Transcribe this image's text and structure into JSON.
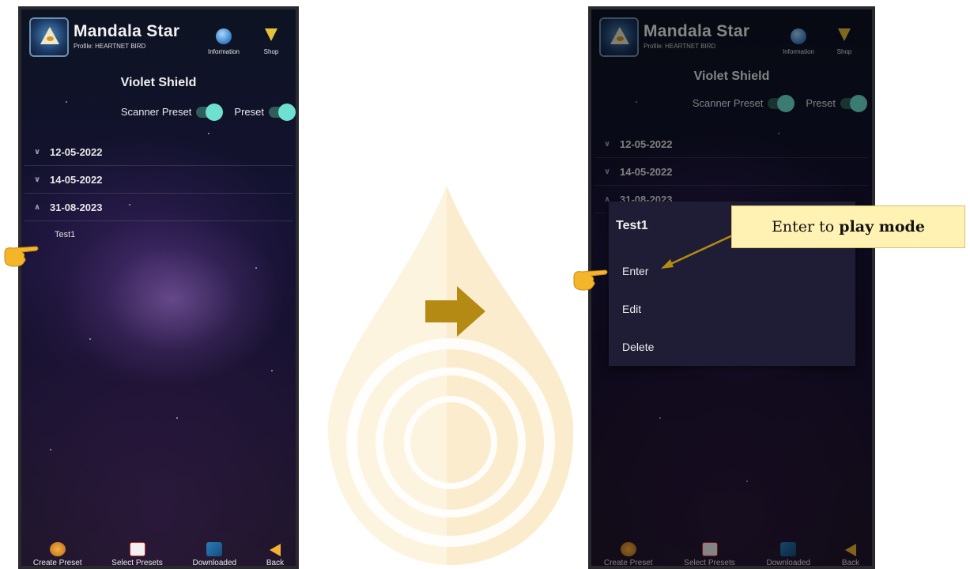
{
  "colors": {
    "accent_toggle": "#6ee0cf",
    "callout_bg": "#fff2b3",
    "arrow": "#b58a14",
    "hand": "#f5b52a"
  },
  "screens": [
    {
      "app_title": "Mandala Star",
      "profile_label": "Profile:",
      "profile_name": "HEARTNET BIRD",
      "info_label": "Information",
      "shop_label": "Shop",
      "preset_title": "Violet Shield",
      "toggle_scanner_label": "Scanner Preset",
      "toggle_preset_label": "Preset",
      "dates": [
        "12-05-2022",
        "14-05-2022",
        "31-08-2023"
      ],
      "child_item": "Test1",
      "nav": [
        "Create Preset",
        "Select Presets",
        "Downloaded",
        "Back"
      ]
    },
    {
      "app_title": "Mandala Star",
      "profile_label": "Profile:",
      "profile_name": "HEARTNET BIRD",
      "info_label": "Information",
      "shop_label": "Shop",
      "preset_title": "Violet Shield",
      "toggle_scanner_label": "Scanner Preset",
      "toggle_preset_label": "Preset",
      "dates": [
        "12-05-2022",
        "14-05-2022",
        "31-08-2023"
      ],
      "context_menu": {
        "title": "Test1",
        "items": [
          "Enter",
          "Edit",
          "Delete"
        ]
      },
      "nav": [
        "Create Preset",
        "Select Presets",
        "Downloaded",
        "Back"
      ]
    }
  ],
  "callout": {
    "prefix": "Enter to ",
    "bold": "play mode"
  }
}
